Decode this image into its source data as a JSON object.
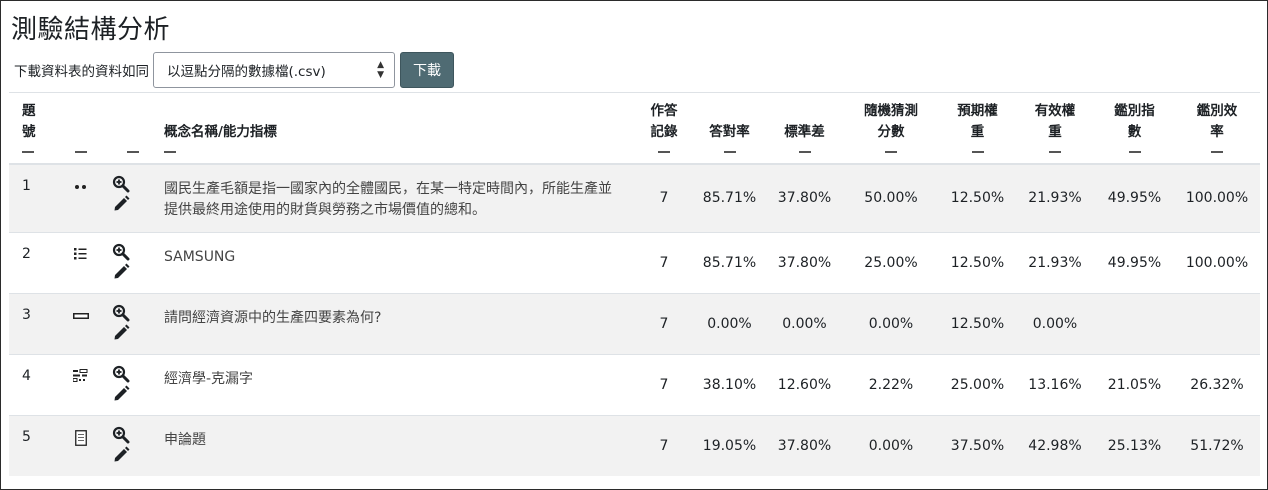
{
  "page": {
    "title": "測驗結構分析"
  },
  "download": {
    "label": "下載資料表的資料如同",
    "selected_format": "以逗點分隔的數據檔(.csv)",
    "button_label": "下載"
  },
  "table": {
    "headers": {
      "index": "題號",
      "name": "概念名稱/能力指標",
      "attempts": "作答記錄",
      "facility": "答對率",
      "sd": "標準差",
      "random_guess": "隨機猜測分數",
      "intended_weight": "預期權重",
      "effective_weight": "有效權重",
      "discrimination_index": "鑑別指數",
      "discrimination_efficiency": "鑑別效率"
    },
    "rows": [
      {
        "index": "1",
        "type_icon": "multiple-choice-dots-icon",
        "name": "國民生產毛額是指一國家內的全體國民，在某一特定時間內，所能生產並提供最終用途使用的財貨與勞務之市場價值的總和。",
        "attempts": "7",
        "facility": "85.71%",
        "sd": "37.80%",
        "random_guess": "50.00%",
        "intended_weight": "12.50%",
        "effective_weight": "21.93%",
        "discrimination_index": "49.95%",
        "discrimination_efficiency": "100.00%"
      },
      {
        "index": "2",
        "type_icon": "multiple-choice-list-icon",
        "name": "SAMSUNG",
        "attempts": "7",
        "facility": "85.71%",
        "sd": "37.80%",
        "random_guess": "25.00%",
        "intended_weight": "12.50%",
        "effective_weight": "21.93%",
        "discrimination_index": "49.95%",
        "discrimination_efficiency": "100.00%"
      },
      {
        "index": "3",
        "type_icon": "short-answer-icon",
        "name": "請問經濟資源中的生產四要素為何?",
        "attempts": "7",
        "facility": "0.00%",
        "sd": "0.00%",
        "random_guess": "0.00%",
        "intended_weight": "12.50%",
        "effective_weight": "0.00%",
        "discrimination_index": "",
        "discrimination_efficiency": ""
      },
      {
        "index": "4",
        "type_icon": "cloze-icon",
        "name": "經濟學-克漏字",
        "attempts": "7",
        "facility": "38.10%",
        "sd": "12.60%",
        "random_guess": "2.22%",
        "intended_weight": "25.00%",
        "effective_weight": "13.16%",
        "discrimination_index": "21.05%",
        "discrimination_efficiency": "26.32%"
      },
      {
        "index": "5",
        "type_icon": "essay-icon",
        "name": "申論題",
        "attempts": "7",
        "facility": "19.05%",
        "sd": "37.80%",
        "random_guess": "0.00%",
        "intended_weight": "37.50%",
        "effective_weight": "42.98%",
        "discrimination_index": "25.13%",
        "discrimination_efficiency": "51.72%"
      }
    ]
  }
}
